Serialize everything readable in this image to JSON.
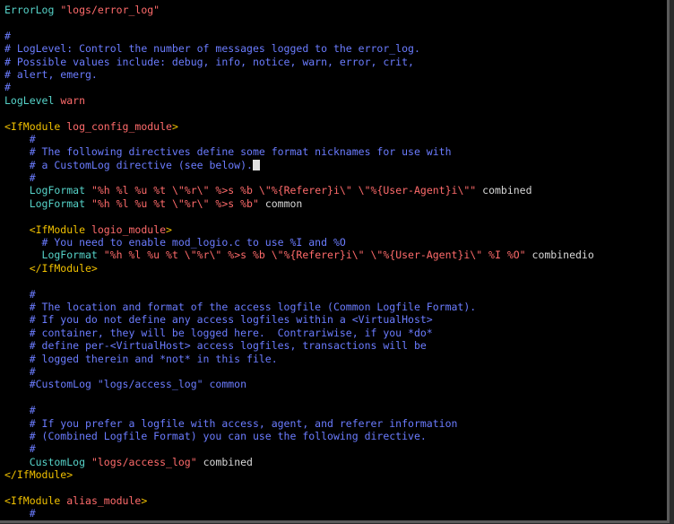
{
  "colors": {
    "background": "#000000",
    "directive": "#56d3c9",
    "string": "#ff6b6b",
    "comment": "#6b7cff",
    "tag": "#f0c000",
    "plain": "#d8d8d8"
  },
  "lines": [
    [
      {
        "t": "directive",
        "s": "ErrorLog"
      },
      {
        "t": "plain",
        "s": " "
      },
      {
        "t": "string",
        "s": "\"logs/error_log\""
      }
    ],
    [],
    [
      {
        "t": "comment",
        "s": "#"
      }
    ],
    [
      {
        "t": "comment",
        "s": "# LogLevel: Control the number of messages logged to the error_log."
      }
    ],
    [
      {
        "t": "comment",
        "s": "# Possible values include: debug, info, notice, warn, error, crit,"
      }
    ],
    [
      {
        "t": "comment",
        "s": "# alert, emerg."
      }
    ],
    [
      {
        "t": "comment",
        "s": "#"
      }
    ],
    [
      {
        "t": "directive",
        "s": "LogLevel"
      },
      {
        "t": "plain",
        "s": " "
      },
      {
        "t": "arg",
        "s": "warn"
      }
    ],
    [],
    [
      {
        "t": "tag",
        "s": "<IfModule"
      },
      {
        "t": "plain",
        "s": " "
      },
      {
        "t": "arg",
        "s": "log_config_module"
      },
      {
        "t": "tag",
        "s": ">"
      }
    ],
    [
      {
        "t": "comment",
        "s": "    #"
      }
    ],
    [
      {
        "t": "comment",
        "s": "    # The following directives define some format nicknames for use with"
      }
    ],
    [
      {
        "t": "comment",
        "s": "    # a CustomLog directive (see below)."
      },
      {
        "t": "cursor",
        "s": ""
      }
    ],
    [
      {
        "t": "comment",
        "s": "    #"
      }
    ],
    [
      {
        "t": "directive",
        "s": "    LogFormat"
      },
      {
        "t": "plain",
        "s": " "
      },
      {
        "t": "string",
        "s": "\"%h %l %u %t \\\"%r\\\" %>s %b \\\"%{Referer}i\\\" \\\"%{User-Agent}i\\\"\""
      },
      {
        "t": "plain",
        "s": " combined"
      }
    ],
    [
      {
        "t": "directive",
        "s": "    LogFormat"
      },
      {
        "t": "plain",
        "s": " "
      },
      {
        "t": "string",
        "s": "\"%h %l %u %t \\\"%r\\\" %>s %b\""
      },
      {
        "t": "plain",
        "s": " common"
      }
    ],
    [],
    [
      {
        "t": "tag",
        "s": "    <IfModule"
      },
      {
        "t": "plain",
        "s": " "
      },
      {
        "t": "arg",
        "s": "logio_module"
      },
      {
        "t": "tag",
        "s": ">"
      }
    ],
    [
      {
        "t": "comment",
        "s": "      # You need to enable mod_logio.c to use %I and %O"
      }
    ],
    [
      {
        "t": "directive",
        "s": "      LogFormat"
      },
      {
        "t": "plain",
        "s": " "
      },
      {
        "t": "string",
        "s": "\"%h %l %u %t \\\"%r\\\" %>s %b \\\"%{Referer}i\\\" \\\"%{User-Agent}i\\\" %I %O\""
      },
      {
        "t": "plain",
        "s": " combinedio"
      }
    ],
    [
      {
        "t": "tag",
        "s": "    </IfModule>"
      }
    ],
    [],
    [
      {
        "t": "comment",
        "s": "    #"
      }
    ],
    [
      {
        "t": "comment",
        "s": "    # The location and format of the access logfile (Common Logfile Format)."
      }
    ],
    [
      {
        "t": "comment",
        "s": "    # If you do not define any access logfiles within a <VirtualHost>"
      }
    ],
    [
      {
        "t": "comment",
        "s": "    # container, they will be logged here.  Contrariwise, if you *do*"
      }
    ],
    [
      {
        "t": "comment",
        "s": "    # define per-<VirtualHost> access logfiles, transactions will be"
      }
    ],
    [
      {
        "t": "comment",
        "s": "    # logged therein and *not* in this file."
      }
    ],
    [
      {
        "t": "comment",
        "s": "    #"
      }
    ],
    [
      {
        "t": "comment",
        "s": "    #CustomLog \"logs/access_log\" common"
      }
    ],
    [],
    [
      {
        "t": "comment",
        "s": "    #"
      }
    ],
    [
      {
        "t": "comment",
        "s": "    # If you prefer a logfile with access, agent, and referer information"
      }
    ],
    [
      {
        "t": "comment",
        "s": "    # (Combined Logfile Format) you can use the following directive."
      }
    ],
    [
      {
        "t": "comment",
        "s": "    #"
      }
    ],
    [
      {
        "t": "directive",
        "s": "    CustomLog"
      },
      {
        "t": "plain",
        "s": " "
      },
      {
        "t": "string",
        "s": "\"logs/access_log\""
      },
      {
        "t": "plain",
        "s": " combined"
      }
    ],
    [
      {
        "t": "tag",
        "s": "</IfModule>"
      }
    ],
    [],
    [
      {
        "t": "tag",
        "s": "<IfModule"
      },
      {
        "t": "plain",
        "s": " "
      },
      {
        "t": "arg",
        "s": "alias_module"
      },
      {
        "t": "tag",
        "s": ">"
      }
    ],
    [
      {
        "t": "comment",
        "s": "    #"
      }
    ]
  ]
}
